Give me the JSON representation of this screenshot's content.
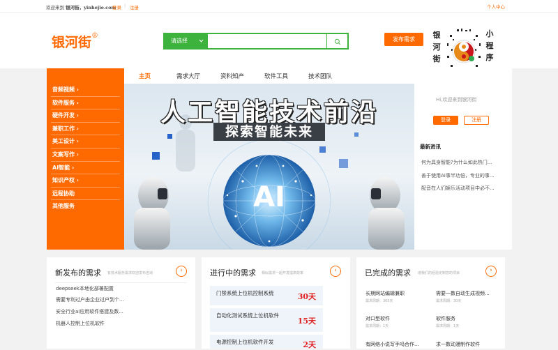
{
  "topbar": {
    "welcome": "欢迎来到",
    "site_name": "银河街，yinhejie.com",
    "login": "登录",
    "separator": "|",
    "register": "注册",
    "user_center": "个人中心"
  },
  "header": {
    "logo_text": "银河街",
    "logo_mark": "®",
    "search": {
      "select_label": "请选择",
      "placeholder": ""
    },
    "publish_button": "发布需求",
    "qr_left": [
      "银",
      "河",
      "街"
    ],
    "qr_right": [
      "小",
      "程",
      "序"
    ]
  },
  "sidemenu": {
    "items": [
      {
        "label": "音频视频",
        "arrow": "›"
      },
      {
        "label": "软件服务",
        "arrow": "›"
      },
      {
        "label": "硬件开发",
        "arrow": "›"
      },
      {
        "label": "兼职工作",
        "arrow": "›"
      },
      {
        "label": "美工设计",
        "arrow": "›"
      },
      {
        "label": "文案写作",
        "arrow": "›"
      },
      {
        "label": "AI智能",
        "arrow": "›"
      },
      {
        "label": "知识产权",
        "arrow": "›"
      },
      {
        "label": "远程协助",
        "arrow": ""
      },
      {
        "label": "其他服务",
        "arrow": ""
      }
    ]
  },
  "nav": {
    "tabs": [
      {
        "label": "主页"
      },
      {
        "label": "需求大厅"
      },
      {
        "label": "资料知产"
      },
      {
        "label": "软件工具"
      },
      {
        "label": "技术团队"
      }
    ]
  },
  "banner": {
    "title": "人工智能技术前沿",
    "subtitle": "探索智能未来",
    "badge": "AI"
  },
  "right_panel": {
    "greeting": "Hi,欢迎来到银河街",
    "login": "登录",
    "register": "注册",
    "news_title": "最新资讯",
    "news": [
      "何为具身智能?为什么如此热门...",
      "善于使用AI事半功倍，专业的事...",
      "配音在人们娱乐活动项目中必不..."
    ]
  },
  "cards": {
    "new": {
      "title": "新发布的需求",
      "subtitle": "有技术服务需求欢迎发布咨询",
      "arrow": "›",
      "items": [
        "deepseek本地化部署配置",
        "需要专利过户由企业过户到个...",
        "安全行业ai应用软件搭建及数...",
        "机器人控制上位机软件"
      ]
    },
    "progress": {
      "title": "进行中的需求",
      "subtitle": "相似需求一起开发提高效率",
      "arrow": "›",
      "items": [
        {
          "title": "门禁系统上位机控制系统",
          "days": "30天"
        },
        {
          "title": "自动化测试系统上位机软件",
          "days": "15天"
        },
        {
          "title": "电源控制上位机软件开发",
          "days": "2天"
        }
      ]
    },
    "done": {
      "title": "已完成的需求",
      "subtitle": "增我们的经验定制您的项目",
      "arrow": "›",
      "items": [
        {
          "title": "长期网站编辑兼职",
          "meta": "需求周期：365天"
        },
        {
          "title": "需要一数自动生成视频...",
          "meta": "需求周期：30天"
        },
        {
          "title": "对口型软件",
          "meta": "需求周期：1天"
        },
        {
          "title": "软件服务",
          "meta": "需求周期：1天"
        },
        {
          "title": "有网络小说写手吗合作...",
          "meta": ""
        },
        {
          "title": "求一数动漫制作软件",
          "meta": ""
        }
      ]
    }
  },
  "colors": {
    "brand": "#ff6a00",
    "search_green": "#3db33d",
    "deadline_red": "#e02020"
  }
}
